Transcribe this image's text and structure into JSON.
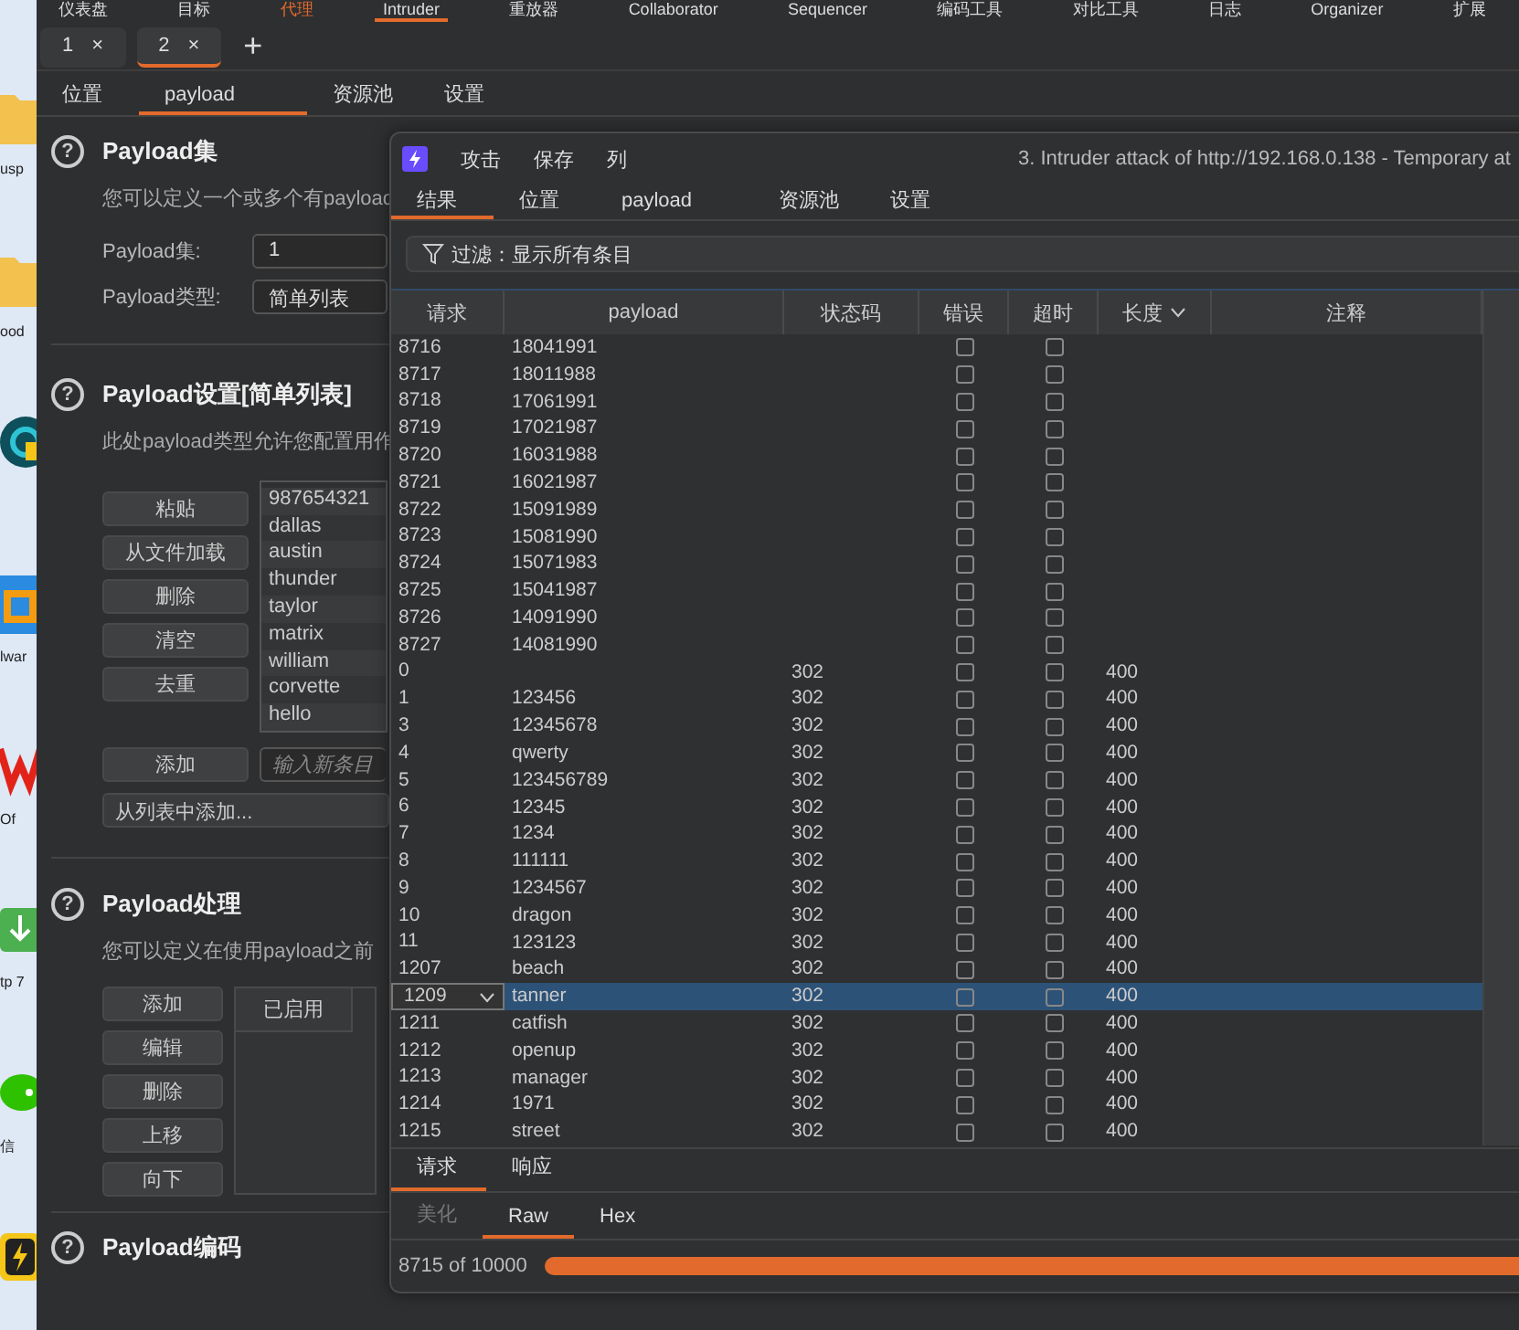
{
  "desktop": {
    "icons": [
      {
        "kind": "folder",
        "label": "usp"
      },
      {
        "kind": "folder",
        "label": "ood"
      },
      {
        "kind": "ring"
      },
      {
        "kind": "frame",
        "label": "lwar"
      },
      {
        "kind": "logo",
        "label": "Of"
      },
      {
        "kind": "download",
        "label": "tp 7"
      },
      {
        "kind": "chat",
        "label": "信"
      },
      {
        "kind": "bolt"
      }
    ]
  },
  "top_nav": [
    {
      "label": "仪表盘",
      "selected": false,
      "highlighted": false
    },
    {
      "label": "目标",
      "selected": false,
      "highlighted": false
    },
    {
      "label": "代理",
      "selected": false,
      "highlighted": true
    },
    {
      "label": "Intruder",
      "selected": true,
      "highlighted": false
    },
    {
      "label": "重放器",
      "selected": false,
      "highlighted": false
    },
    {
      "label": "Collaborator",
      "selected": false,
      "highlighted": false
    },
    {
      "label": "Sequencer",
      "selected": false,
      "highlighted": false
    },
    {
      "label": "编码工具",
      "selected": false,
      "highlighted": false
    },
    {
      "label": "对比工具",
      "selected": false,
      "highlighted": false
    },
    {
      "label": "日志",
      "selected": false,
      "highlighted": false
    },
    {
      "label": "Organizer",
      "selected": false,
      "highlighted": false
    },
    {
      "label": "扩展",
      "selected": false,
      "highlighted": false
    }
  ],
  "attack_tabs": {
    "items": [
      {
        "label": "1",
        "close": "×",
        "selected": false
      },
      {
        "label": "2",
        "close": "×",
        "selected": true
      }
    ],
    "add": "+"
  },
  "sub_tabs": [
    {
      "label": "位置",
      "selected": false
    },
    {
      "label": "payload",
      "selected": true
    },
    {
      "label": "资源池",
      "selected": false
    },
    {
      "label": "设置",
      "selected": false
    }
  ],
  "payload_sets": {
    "help": "?",
    "title": "Payload集",
    "description": "您可以定义一个或多个有payload",
    "fields": [
      {
        "label": "Payload集:",
        "value": "1"
      },
      {
        "label": "Payload类型:",
        "value": "简单列表"
      }
    ]
  },
  "payload_settings": {
    "help": "?",
    "title": "Payload设置[简单列表]",
    "description": "此处payload类型允许您配置用作",
    "buttons": [
      "粘贴",
      "从文件加载",
      "删除",
      "清空",
      "去重"
    ],
    "list": [
      "987654321",
      "dallas",
      "austin",
      "thunder",
      "taylor",
      "matrix",
      "william",
      "corvette",
      "hello"
    ],
    "add_button": "添加",
    "add_placeholder": "输入新条目",
    "add_from_list": "从列表中添加..."
  },
  "payload_processing": {
    "help": "?",
    "title": "Payload处理",
    "description": "您可以定义在使用payload之前",
    "buttons": [
      "添加",
      "编辑",
      "删除",
      "上移",
      "向下"
    ],
    "table_columns": [
      "已启用"
    ]
  },
  "payload_encoding": {
    "help": "?",
    "title": "Payload编码"
  },
  "attack_window": {
    "menu": [
      "攻击",
      "保存",
      "列"
    ],
    "title": "3. Intruder attack of http://192.168.0.138 - Temporary at",
    "tabs": [
      {
        "label": "结果",
        "selected": true
      },
      {
        "label": "位置",
        "selected": false
      },
      {
        "label": "payload",
        "selected": false
      },
      {
        "label": "资源池",
        "selected": false
      },
      {
        "label": "设置",
        "selected": false
      }
    ],
    "filter": "过滤：显示所有条目",
    "columns": [
      "请求",
      "payload",
      "状态码",
      "错误",
      "超时",
      "长度",
      "注释"
    ],
    "rows": [
      {
        "request": "8716",
        "payload": "18041991",
        "status": "",
        "error": false,
        "timeout": false,
        "length": "",
        "selected": false
      },
      {
        "request": "8717",
        "payload": "18011988",
        "status": "",
        "error": false,
        "timeout": false,
        "length": "",
        "selected": false
      },
      {
        "request": "8718",
        "payload": "17061991",
        "status": "",
        "error": false,
        "timeout": false,
        "length": "",
        "selected": false
      },
      {
        "request": "8719",
        "payload": "17021987",
        "status": "",
        "error": false,
        "timeout": false,
        "length": "",
        "selected": false
      },
      {
        "request": "8720",
        "payload": "16031988",
        "status": "",
        "error": false,
        "timeout": false,
        "length": "",
        "selected": false
      },
      {
        "request": "8721",
        "payload": "16021987",
        "status": "",
        "error": false,
        "timeout": false,
        "length": "",
        "selected": false
      },
      {
        "request": "8722",
        "payload": "15091989",
        "status": "",
        "error": false,
        "timeout": false,
        "length": "",
        "selected": false
      },
      {
        "request": "8723",
        "payload": "15081990",
        "status": "",
        "error": false,
        "timeout": false,
        "length": "",
        "selected": false
      },
      {
        "request": "8724",
        "payload": "15071983",
        "status": "",
        "error": false,
        "timeout": false,
        "length": "",
        "selected": false
      },
      {
        "request": "8725",
        "payload": "15041987",
        "status": "",
        "error": false,
        "timeout": false,
        "length": "",
        "selected": false
      },
      {
        "request": "8726",
        "payload": "14091990",
        "status": "",
        "error": false,
        "timeout": false,
        "length": "",
        "selected": false
      },
      {
        "request": "8727",
        "payload": "14081990",
        "status": "",
        "error": false,
        "timeout": false,
        "length": "",
        "selected": false
      },
      {
        "request": "0",
        "payload": "",
        "status": "302",
        "error": false,
        "timeout": false,
        "length": "400",
        "selected": false
      },
      {
        "request": "1",
        "payload": "123456",
        "status": "302",
        "error": false,
        "timeout": false,
        "length": "400",
        "selected": false
      },
      {
        "request": "3",
        "payload": "12345678",
        "status": "302",
        "error": false,
        "timeout": false,
        "length": "400",
        "selected": false
      },
      {
        "request": "4",
        "payload": "qwerty",
        "status": "302",
        "error": false,
        "timeout": false,
        "length": "400",
        "selected": false
      },
      {
        "request": "5",
        "payload": "123456789",
        "status": "302",
        "error": false,
        "timeout": false,
        "length": "400",
        "selected": false
      },
      {
        "request": "6",
        "payload": "12345",
        "status": "302",
        "error": false,
        "timeout": false,
        "length": "400",
        "selected": false
      },
      {
        "request": "7",
        "payload": "1234",
        "status": "302",
        "error": false,
        "timeout": false,
        "length": "400",
        "selected": false
      },
      {
        "request": "8",
        "payload": "111111",
        "status": "302",
        "error": false,
        "timeout": false,
        "length": "400",
        "selected": false
      },
      {
        "request": "9",
        "payload": "1234567",
        "status": "302",
        "error": false,
        "timeout": false,
        "length": "400",
        "selected": false
      },
      {
        "request": "10",
        "payload": "dragon",
        "status": "302",
        "error": false,
        "timeout": false,
        "length": "400",
        "selected": false
      },
      {
        "request": "11",
        "payload": "123123",
        "status": "302",
        "error": false,
        "timeout": false,
        "length": "400",
        "selected": false
      },
      {
        "request": "1207",
        "payload": "beach",
        "status": "302",
        "error": false,
        "timeout": false,
        "length": "400",
        "selected": false
      },
      {
        "request": "1209",
        "payload": "tanner",
        "status": "302",
        "error": false,
        "timeout": false,
        "length": "400",
        "selected": true
      },
      {
        "request": "1211",
        "payload": "catfish",
        "status": "302",
        "error": false,
        "timeout": false,
        "length": "400",
        "selected": false
      },
      {
        "request": "1212",
        "payload": "openup",
        "status": "302",
        "error": false,
        "timeout": false,
        "length": "400",
        "selected": false
      },
      {
        "request": "1213",
        "payload": "manager",
        "status": "302",
        "error": false,
        "timeout": false,
        "length": "400",
        "selected": false
      },
      {
        "request": "1214",
        "payload": "1971",
        "status": "302",
        "error": false,
        "timeout": false,
        "length": "400",
        "selected": false
      },
      {
        "request": "1215",
        "payload": "street",
        "status": "302",
        "error": false,
        "timeout": false,
        "length": "400",
        "selected": false
      }
    ],
    "detail_tabs": [
      {
        "label": "请求",
        "selected": true
      },
      {
        "label": "响应",
        "selected": false
      }
    ],
    "view_tabs": [
      {
        "label": "美化",
        "selected": false,
        "disabled": true
      },
      {
        "label": "Raw",
        "selected": true,
        "disabled": false
      },
      {
        "label": "Hex",
        "selected": false,
        "disabled": false
      }
    ],
    "progress": {
      "text": "8715 of 10000",
      "level": 0.8715
    }
  }
}
